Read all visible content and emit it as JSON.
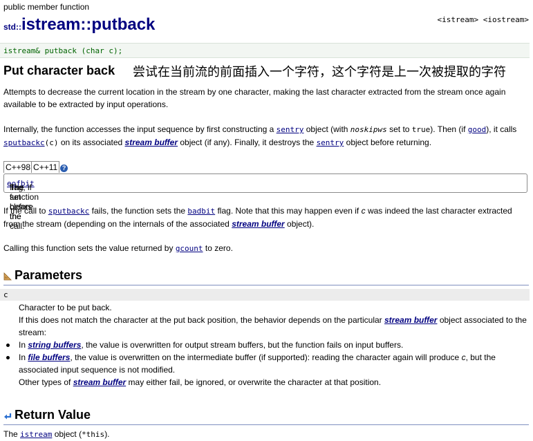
{
  "header": {
    "kind": "public member function",
    "namespace": "std::",
    "class_name": "istream",
    "separator": "::",
    "function_name": "putback",
    "headers": "<istream> <iostream>"
  },
  "prototype": "istream& putback (char c);",
  "short_desc": "Put character back",
  "note_cn": "尝试在当前流的前面插入一个字符，这个字符是上一次被提取的字符",
  "para1": "Attempts to decrease the current location in the stream by one character, making the last character extracted from the stream once again available to be extracted by input operations.",
  "para2": {
    "t1": "Internally, the function accesses the input sequence by first constructing a ",
    "sentry": "sentry",
    "t2": " object (with ",
    "noskipws": "noskipws",
    "t3": " set to ",
    "true": "true",
    "t4": "). Then (if ",
    "good": "good",
    "t5": "), it calls ",
    "sputbackc": "sputbackc",
    "args": "(c)",
    "t6": " on its associated ",
    "stream_buffer": "stream buffer",
    "t7": " object (if any). Finally, it destroys the ",
    "sentry2": "sentry",
    "t8": " object before returning."
  },
  "version_tabs": [
    "C++98",
    "C++11"
  ],
  "help_icon": "?",
  "version_box": {
    "t1": "The function clears the ",
    "eofbit": "eofbit",
    "t2": " flag, if set before the call."
  },
  "para3": {
    "t1": "If the call to ",
    "sputbackc": "sputbackc",
    "t2": " fails, the function sets the ",
    "badbit": "badbit",
    "t3": " flag. Note that this may happen even if ",
    "c": "c",
    "t4": " was indeed the last character extracted from the stream (depending on the internals of the associated ",
    "stream_buffer": "stream buffer",
    "t5": " object)."
  },
  "para4": {
    "t1": "Calling this function sets the value returned by ",
    "gcount": "gcount",
    "t2": " to zero."
  },
  "parameters": {
    "heading": "Parameters",
    "name": "c",
    "desc": "Character to be put back.",
    "detail_t1": "If this does not match the character at the put back position, the behavior depends on the particular ",
    "detail_link": "stream buffer",
    "detail_t2": " object associated to the stream:",
    "bullets": [
      {
        "link": "string buffers",
        "rest": ", the value is overwritten for output stream buffers, but the function fails on input buffers."
      },
      {
        "link": "file buffers",
        "rest_a": ", the value is overwritten on the intermediate buffer (if supported): reading the character again will produce ",
        "c": "c",
        "rest_b": ", but the associated input sequence is not modified."
      }
    ],
    "bullet_prefix": "In ",
    "other_t1": "Other types of ",
    "other_link": "stream buffer",
    "other_t2": " may either fail, be ignored, or overwrite the character at that position."
  },
  "return_value": {
    "heading": "Return Value",
    "t1": "The ",
    "link": "istream",
    "t2": " object (",
    "code": "*this",
    "t3": ")."
  },
  "colors": {
    "title": "#000080",
    "link": "#000080",
    "prototype_text": "#006400",
    "rule": "#7f8fbf"
  },
  "icons": [
    "help-icon",
    "parameters-icon",
    "return-value-icon"
  ]
}
